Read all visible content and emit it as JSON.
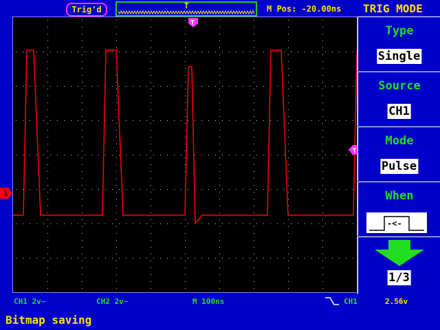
{
  "topbar": {
    "trig_status": "Trig'd",
    "m_pos": "M Pos: -20.00ns",
    "trigger_marker": "T"
  },
  "menu": {
    "title": "TRIG MODE",
    "items": [
      {
        "label": "Type",
        "value": "Single"
      },
      {
        "label": "Source",
        "value": "CH1"
      },
      {
        "label": "Mode",
        "value": "Pulse"
      },
      {
        "label": "When",
        "value": "-<-"
      },
      {
        "label": "",
        "value": "1/3"
      }
    ]
  },
  "markers": {
    "ch1": "1",
    "trigger_level": "T",
    "trigger_pos": "T"
  },
  "status": {
    "ch1": "CH1  2v~",
    "ch2": "CH2  2v~",
    "timebase": "M  100ns",
    "trig_source": "CH1",
    "trig_level": "2.56v"
  },
  "message": "Bitmap saving",
  "colors": {
    "background": "#0000c8",
    "trace": "#ff0000",
    "menu_label": "#22dd22",
    "text": "#ffe000",
    "marker": "#ff33ff"
  },
  "trace_samples": {
    "low": [
      [
        0,
        0.28
      ],
      [
        0.03,
        0.28
      ],
      [
        0.04,
        0.88
      ],
      [
        0.06,
        0.88
      ],
      [
        0.08,
        0.28
      ],
      [
        0.1,
        0.28
      ],
      [
        0.26,
        0.28
      ],
      [
        0.27,
        0.88
      ],
      [
        0.3,
        0.88
      ],
      [
        0.32,
        0.28
      ],
      [
        0.34,
        0.28
      ],
      [
        0.5,
        0.28
      ],
      [
        0.51,
        0.82
      ],
      [
        0.52,
        0.82
      ],
      [
        0.53,
        0.25
      ],
      [
        0.55,
        0.28
      ],
      [
        0.74,
        0.28
      ],
      [
        0.75,
        0.88
      ],
      [
        0.78,
        0.88
      ],
      [
        0.8,
        0.28
      ],
      [
        0.82,
        0.28
      ],
      [
        0.99,
        0.28
      ],
      [
        1,
        0.88
      ]
    ]
  }
}
